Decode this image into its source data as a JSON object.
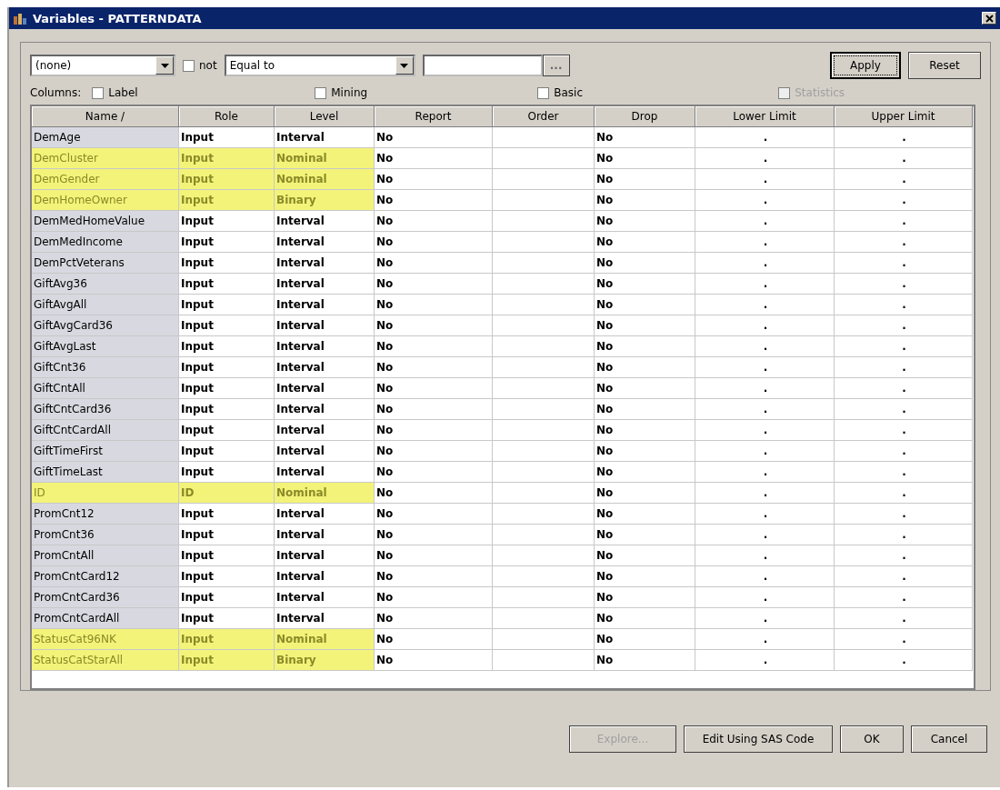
{
  "window": {
    "title": "Variables - PATTERNDATA"
  },
  "filter": {
    "column_dropdown": "(none)",
    "not_checkbox": {
      "label": "not",
      "checked": false
    },
    "operator_dropdown": "Equal to",
    "browse_button": {
      "label": "...",
      "disabled": true
    },
    "buttons": [
      {
        "label": "Apply",
        "focused": true
      },
      {
        "label": "Reset",
        "focused": false
      }
    ]
  },
  "columns_options": {
    "label": "Columns:",
    "checkboxes": [
      {
        "label": "Label",
        "checked": false,
        "disabled": false
      },
      {
        "label": "Mining",
        "checked": false,
        "disabled": false
      },
      {
        "label": "Basic",
        "checked": false,
        "disabled": false
      },
      {
        "label": "Statistics",
        "checked": false,
        "disabled": true
      }
    ]
  },
  "table": {
    "columns": [
      "Name /",
      "Role",
      "Level",
      "Report",
      "Order",
      "Drop",
      "Lower Limit",
      "Upper Limit"
    ],
    "rows": [
      {
        "name": "DemAge",
        "role": "Input",
        "level": "Interval",
        "report": "No",
        "order": "",
        "drop": "No",
        "lower_limit": ".",
        "upper_limit": ".",
        "highlighted": false
      },
      {
        "name": "DemCluster",
        "role": "Input",
        "level": "Nominal",
        "report": "No",
        "order": "",
        "drop": "No",
        "lower_limit": ".",
        "upper_limit": ".",
        "highlighted": true
      },
      {
        "name": "DemGender",
        "role": "Input",
        "level": "Nominal",
        "report": "No",
        "order": "",
        "drop": "No",
        "lower_limit": ".",
        "upper_limit": ".",
        "highlighted": true
      },
      {
        "name": "DemHomeOwner",
        "role": "Input",
        "level": "Binary",
        "report": "No",
        "order": "",
        "drop": "No",
        "lower_limit": ".",
        "upper_limit": ".",
        "highlighted": true
      },
      {
        "name": "DemMedHomeValue",
        "role": "Input",
        "level": "Interval",
        "report": "No",
        "order": "",
        "drop": "No",
        "lower_limit": ".",
        "upper_limit": ".",
        "highlighted": false
      },
      {
        "name": "DemMedIncome",
        "role": "Input",
        "level": "Interval",
        "report": "No",
        "order": "",
        "drop": "No",
        "lower_limit": ".",
        "upper_limit": ".",
        "highlighted": false
      },
      {
        "name": "DemPctVeterans",
        "role": "Input",
        "level": "Interval",
        "report": "No",
        "order": "",
        "drop": "No",
        "lower_limit": ".",
        "upper_limit": ".",
        "highlighted": false
      },
      {
        "name": "GiftAvg36",
        "role": "Input",
        "level": "Interval",
        "report": "No",
        "order": "",
        "drop": "No",
        "lower_limit": ".",
        "upper_limit": ".",
        "highlighted": false
      },
      {
        "name": "GiftAvgAll",
        "role": "Input",
        "level": "Interval",
        "report": "No",
        "order": "",
        "drop": "No",
        "lower_limit": ".",
        "upper_limit": ".",
        "highlighted": false
      },
      {
        "name": "GiftAvgCard36",
        "role": "Input",
        "level": "Interval",
        "report": "No",
        "order": "",
        "drop": "No",
        "lower_limit": ".",
        "upper_limit": ".",
        "highlighted": false
      },
      {
        "name": "GiftAvgLast",
        "role": "Input",
        "level": "Interval",
        "report": "No",
        "order": "",
        "drop": "No",
        "lower_limit": ".",
        "upper_limit": ".",
        "highlighted": false
      },
      {
        "name": "GiftCnt36",
        "role": "Input",
        "level": "Interval",
        "report": "No",
        "order": "",
        "drop": "No",
        "lower_limit": ".",
        "upper_limit": ".",
        "highlighted": false
      },
      {
        "name": "GiftCntAll",
        "role": "Input",
        "level": "Interval",
        "report": "No",
        "order": "",
        "drop": "No",
        "lower_limit": ".",
        "upper_limit": ".",
        "highlighted": false
      },
      {
        "name": "GiftCntCard36",
        "role": "Input",
        "level": "Interval",
        "report": "No",
        "order": "",
        "drop": "No",
        "lower_limit": ".",
        "upper_limit": ".",
        "highlighted": false
      },
      {
        "name": "GiftCntCardAll",
        "role": "Input",
        "level": "Interval",
        "report": "No",
        "order": "",
        "drop": "No",
        "lower_limit": ".",
        "upper_limit": ".",
        "highlighted": false
      },
      {
        "name": "GiftTimeFirst",
        "role": "Input",
        "level": "Interval",
        "report": "No",
        "order": "",
        "drop": "No",
        "lower_limit": ".",
        "upper_limit": ".",
        "highlighted": false
      },
      {
        "name": "GiftTimeLast",
        "role": "Input",
        "level": "Interval",
        "report": "No",
        "order": "",
        "drop": "No",
        "lower_limit": ".",
        "upper_limit": ".",
        "highlighted": false
      },
      {
        "name": "ID",
        "role": "ID",
        "level": "Nominal",
        "report": "No",
        "order": "",
        "drop": "No",
        "lower_limit": ".",
        "upper_limit": ".",
        "highlighted": true
      },
      {
        "name": "PromCnt12",
        "role": "Input",
        "level": "Interval",
        "report": "No",
        "order": "",
        "drop": "No",
        "lower_limit": ".",
        "upper_limit": ".",
        "highlighted": false
      },
      {
        "name": "PromCnt36",
        "role": "Input",
        "level": "Interval",
        "report": "No",
        "order": "",
        "drop": "No",
        "lower_limit": ".",
        "upper_limit": ".",
        "highlighted": false
      },
      {
        "name": "PromCntAll",
        "role": "Input",
        "level": "Interval",
        "report": "No",
        "order": "",
        "drop": "No",
        "lower_limit": ".",
        "upper_limit": ".",
        "highlighted": false
      },
      {
        "name": "PromCntCard12",
        "role": "Input",
        "level": "Interval",
        "report": "No",
        "order": "",
        "drop": "No",
        "lower_limit": ".",
        "upper_limit": ".",
        "highlighted": false
      },
      {
        "name": "PromCntCard36",
        "role": "Input",
        "level": "Interval",
        "report": "No",
        "order": "",
        "drop": "No",
        "lower_limit": ".",
        "upper_limit": ".",
        "highlighted": false
      },
      {
        "name": "PromCntCardAll",
        "role": "Input",
        "level": "Interval",
        "report": "No",
        "order": "",
        "drop": "No",
        "lower_limit": ".",
        "upper_limit": ".",
        "highlighted": false
      },
      {
        "name": "StatusCat96NK",
        "role": "Input",
        "level": "Nominal",
        "report": "No",
        "order": "",
        "drop": "No",
        "lower_limit": ".",
        "upper_limit": ".",
        "highlighted": true
      },
      {
        "name": "StatusCatStarAll",
        "role": "Input",
        "level": "Binary",
        "report": "No",
        "order": "",
        "drop": "No",
        "lower_limit": ".",
        "upper_limit": ".",
        "highlighted": true
      }
    ]
  },
  "footer_buttons": [
    {
      "label": "Explore...",
      "disabled": true
    },
    {
      "label": "Edit Using SAS Code",
      "disabled": false
    },
    {
      "label": "OK",
      "disabled": false
    },
    {
      "label": "Cancel",
      "disabled": false
    }
  ]
}
